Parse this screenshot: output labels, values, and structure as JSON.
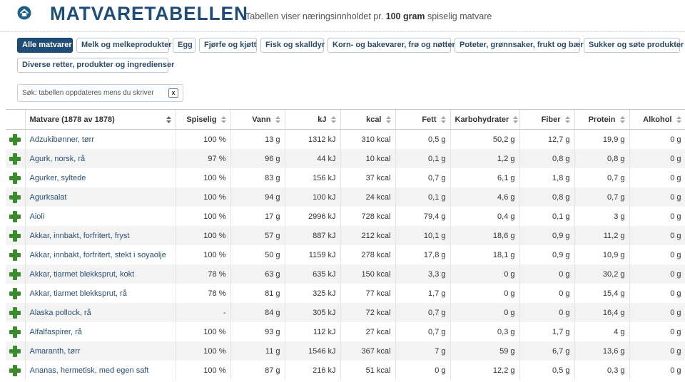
{
  "header": {
    "brand": "MATVARETABELLEN",
    "tagline_pre": "Tabellen viser næringsinnholdet pr. ",
    "tagline_bold": "100 gram",
    "tagline_post": " spiselig matvare"
  },
  "filters": [
    {
      "label": "Alle matvarer",
      "active": true
    },
    {
      "label": "Melk og melkeprodukter",
      "active": false
    },
    {
      "label": "Egg",
      "active": false
    },
    {
      "label": "Fjørfe og kjøtt",
      "active": false
    },
    {
      "label": "Fisk og skalldyr",
      "active": false
    },
    {
      "label": "Korn- og bakevarer, frø og nøtter",
      "active": false
    },
    {
      "label": "Poteter, grønnsaker, frukt og bær",
      "active": false
    },
    {
      "label": "Sukker og søte produkter",
      "active": false
    },
    {
      "label": "Diverse retter, produkter og ingredienser",
      "active": false
    }
  ],
  "search": {
    "placeholder": "Søk: tabellen oppdateres mens du skriver",
    "value": "",
    "clear_label": "x"
  },
  "table": {
    "columns": [
      "Matvare (1878 av 1878)",
      "Spiselig",
      "Vann",
      "kJ",
      "kcal",
      "Fett",
      "Karbohydrater",
      "Fiber",
      "Protein",
      "Alkohol"
    ],
    "rows": [
      [
        "Adzukibønner, tørr",
        "100 %",
        "13 g",
        "1312 kJ",
        "310 kcal",
        "0,5 g",
        "50,2 g",
        "12,7 g",
        "19,9 g",
        "0 g"
      ],
      [
        "Agurk, norsk, rå",
        "97 %",
        "96 g",
        "44 kJ",
        "10 kcal",
        "0,1 g",
        "1,2 g",
        "0,8 g",
        "0,8 g",
        "0 g"
      ],
      [
        "Agurker, syltede",
        "100 %",
        "83 g",
        "156 kJ",
        "37 kcal",
        "0,7 g",
        "6,1 g",
        "1,8 g",
        "0,7 g",
        "0 g"
      ],
      [
        "Agurksalat",
        "100 %",
        "94 g",
        "100 kJ",
        "24 kcal",
        "0,1 g",
        "4,6 g",
        "0,8 g",
        "0,7 g",
        "0 g"
      ],
      [
        "Aioli",
        "100 %",
        "17 g",
        "2996 kJ",
        "728 kcal",
        "79,4 g",
        "0,4 g",
        "0,1 g",
        "3 g",
        "0 g"
      ],
      [
        "Akkar, innbakt, forfritert, fryst",
        "100 %",
        "57 g",
        "887 kJ",
        "212 kcal",
        "10,1 g",
        "18,6 g",
        "0,9 g",
        "11,2 g",
        "0 g"
      ],
      [
        "Akkar, innbakt, forfritert, stekt i soyaolje",
        "100 %",
        "50 g",
        "1159 kJ",
        "278 kcal",
        "17,8 g",
        "18,1 g",
        "0,9 g",
        "10,9 g",
        "0 g"
      ],
      [
        "Akkar, tiarmet blekksprut, kokt",
        "78 %",
        "63 g",
        "635 kJ",
        "150 kcal",
        "3,3 g",
        "0 g",
        "0 g",
        "30,2 g",
        "0 g"
      ],
      [
        "Akkar, tiarmet blekksprut, rå",
        "78 %",
        "81 g",
        "325 kJ",
        "77 kcal",
        "1,7 g",
        "0 g",
        "0 g",
        "15,4 g",
        "0 g"
      ],
      [
        "Alaska pollock, rå",
        "-",
        "84 g",
        "305 kJ",
        "72 kcal",
        "0,7 g",
        "0 g",
        "0 g",
        "16,4 g",
        "0 g"
      ],
      [
        "Alfalfaspirer, rå",
        "100 %",
        "93 g",
        "112 kJ",
        "27 kcal",
        "0,7 g",
        "0,3 g",
        "1,7 g",
        "4 g",
        "0 g"
      ],
      [
        "Amaranth, tørr",
        "100 %",
        "11 g",
        "1546 kJ",
        "367 kcal",
        "7 g",
        "59 g",
        "6,7 g",
        "13,6 g",
        "0 g"
      ],
      [
        "Ananas, hermetisk, med egen saft",
        "100 %",
        "87 g",
        "216 kJ",
        "51 kcal",
        "0 g",
        "12,2 g",
        "0,5 g",
        "0,3 g",
        "0 g"
      ]
    ]
  }
}
